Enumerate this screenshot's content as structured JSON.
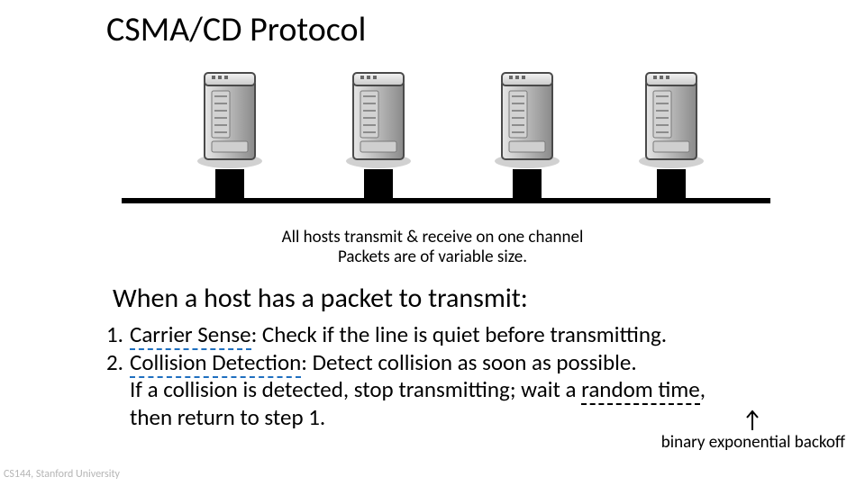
{
  "title": "CSMA/CD Protocol",
  "caption_line1": "All hosts transmit & receive on one channel",
  "caption_line2": "Packets are of variable size.",
  "subheading": "When a host has a packet to transmit:",
  "steps": {
    "s1_num": "1.",
    "s1_term": "Carrier Sense",
    "s1_rest": ":  Check if the line is quiet before transmitting.",
    "s2_num": "2.",
    "s2_term": "Collision Detection",
    "s2_rest": ":  Detect collision as soon as possible.",
    "s2_line2a": "If a collision is detected, stop transmitting; wait a ",
    "s2_line2_rand": "random time",
    "s2_line2b": ",",
    "s2_line3": "then return to step 1."
  },
  "annotation": "binary exponential backoff",
  "footer": "CS144, Stanford University"
}
